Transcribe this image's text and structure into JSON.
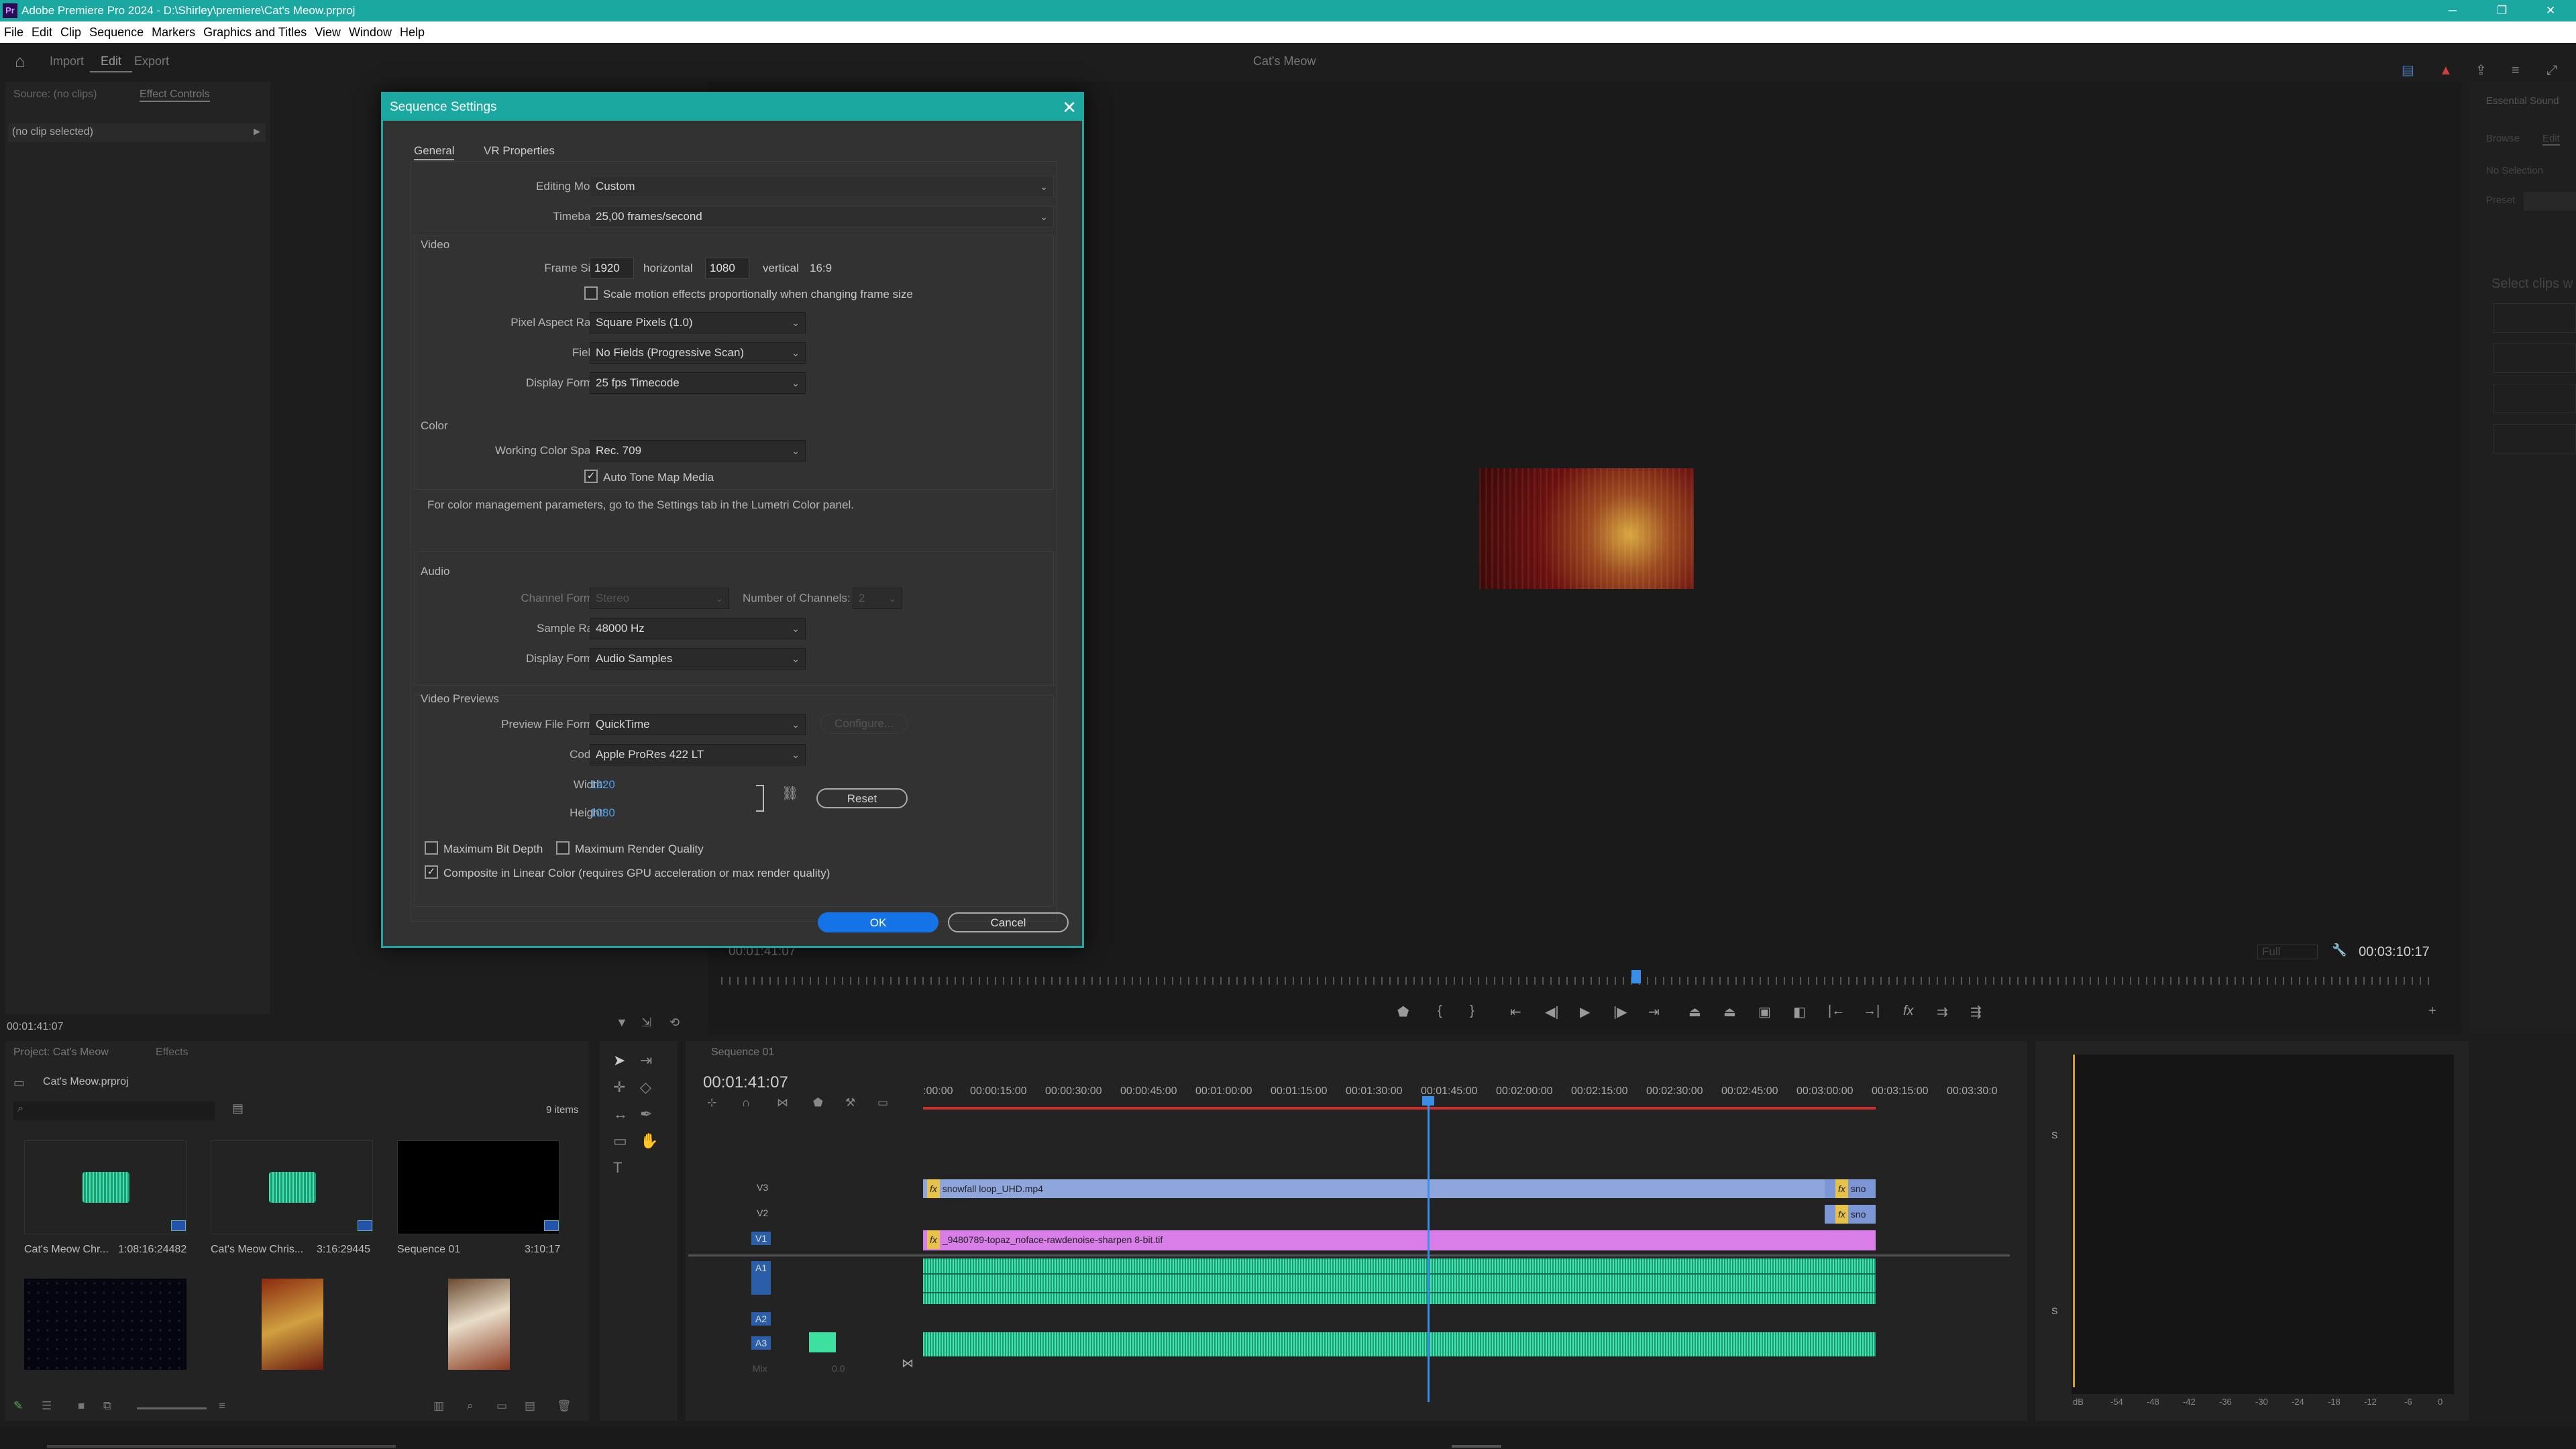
{
  "titlebar": {
    "title": "Adobe Premiere Pro 2024 - D:\\Shirley\\premiere\\Cat's Meow.prproj",
    "app_badge": "Pr"
  },
  "menu": [
    "File",
    "Edit",
    "Clip",
    "Sequence",
    "Markers",
    "Graphics and Titles",
    "View",
    "Window",
    "Help"
  ],
  "toolbar": {
    "import": "Import",
    "edit": "Edit",
    "export": "Export",
    "project_name": "Cat's Meow"
  },
  "source_panel": {
    "tab_source": "Source: (no clips)",
    "tab_effect_controls": "Effect Controls",
    "no_clip": "(no clip selected)",
    "timecode": "00:01:41:07"
  },
  "program_panel": {
    "timecode_left": "00:01:41:07",
    "timecode_right": "00:03:10:17",
    "fit": "Full"
  },
  "essential_sound": {
    "title": "Essential Sound",
    "tab_browse": "Browse",
    "tab_edit": "Edit",
    "no_selection": "No Selection",
    "preset": "Preset",
    "select_clips": "Select clips w"
  },
  "project_panel": {
    "tab_project": "Project: Cat's Meow",
    "tab_effects": "Effects",
    "file": "Cat's Meow.prproj",
    "count": "9 items",
    "items": [
      {
        "name": "Cat's Meow Chr...",
        "duration": "1:08:16:24482"
      },
      {
        "name": "Cat's Meow Chris...",
        "duration": "3:16:29445"
      },
      {
        "name": "Sequence 01",
        "duration": "3:10:17"
      }
    ]
  },
  "timeline": {
    "tab": "Sequence 01",
    "timecode": "00:01:41:07",
    "ruler": [
      ":00:00",
      "00:00:15:00",
      "00:00:30:00",
      "00:00:45:00",
      "00:01:00:00",
      "00:01:15:00",
      "00:01:30:00",
      "00:01:45:00",
      "00:02:00:00",
      "00:02:15:00",
      "00:02:30:00",
      "00:02:45:00",
      "00:03:00:00",
      "00:03:15:00",
      "00:03:30:0"
    ],
    "tracks": [
      "V3",
      "V2",
      "V1",
      "A1",
      "A2",
      "A3",
      "Mix"
    ],
    "mix_value": "0.0",
    "clip_v3": "snowfall loop_UHD.mp4",
    "clip_v3b": "sno",
    "clip_v2b": "sno",
    "clip_v1": "_9480789-topaz_noface-rawdenoise-sharpen 8-bit.tif",
    "fx": "fx"
  },
  "meter": {
    "ticks": [
      "dB",
      "-54",
      "-48",
      "-42",
      "-36",
      "-30",
      "-24",
      "-18",
      "-12",
      "-6",
      "0"
    ]
  },
  "dialog": {
    "title": "Sequence Settings",
    "tabs": [
      "General",
      "VR Properties"
    ],
    "editing_mode_label": "Editing Mode:",
    "editing_mode": "Custom",
    "timebase_label": "Timebase:",
    "timebase": "25,00  frames/second",
    "video_section": "Video",
    "frame_size_label": "Frame Size:",
    "frame_w": "1920",
    "horizontal": "horizontal",
    "frame_h": "1080",
    "vertical": "vertical",
    "aspect": "16:9",
    "scale_motion": "Scale motion effects proportionally when changing frame size",
    "par_label": "Pixel Aspect Ratio:",
    "par": "Square Pixels (1.0)",
    "fields_label": "Fields:",
    "fields": "No Fields (Progressive Scan)",
    "display_format_label": "Display Format:",
    "display_format": "25 fps Timecode",
    "color_section": "Color",
    "wcs_label": "Working Color Space:",
    "wcs": "Rec. 709",
    "auto_tone": "Auto Tone Map Media",
    "color_note": "For color management parameters, go to the Settings tab in the Lumetri Color panel.",
    "audio_section": "Audio",
    "channel_format_label": "Channel Format:",
    "channel_format": "Stereo",
    "num_channels_label": "Number of Channels:",
    "num_channels": "2",
    "sample_rate_label": "Sample Rate:",
    "sample_rate": "48000 Hz",
    "audio_display_label": "Display Format:",
    "audio_display": "Audio Samples",
    "previews_section": "Video Previews",
    "preview_format_label": "Preview File Format:",
    "preview_format": "QuickTime",
    "configure": "Configure...",
    "codec_label": "Codec:",
    "codec": "Apple ProRes 422 LT",
    "width_label": "Width:",
    "width": "1920",
    "height_label": "Height:",
    "height": "1080",
    "reset": "Reset",
    "max_bit_depth": "Maximum Bit Depth",
    "max_render_quality": "Maximum Render Quality",
    "composite_linear": "Composite in Linear Color (requires GPU acceleration or max render quality)",
    "ok": "OK",
    "cancel": "Cancel"
  },
  "colors": {
    "accent": "#1ba8a0",
    "ok_blue": "#1473e6",
    "playhead": "#3a8ee6",
    "video_clip": "#8fa6dc",
    "pink_clip": "#d97ee8",
    "audio_clip": "#1b9c78"
  }
}
